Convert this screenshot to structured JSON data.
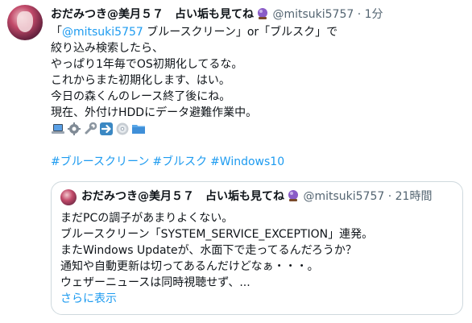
{
  "tweet": {
    "display_name": "おだみつき@美月５７　占い垢も見てね",
    "handle": "@mitsuki5757",
    "separator": "·",
    "time": "1分",
    "text_lines": [
      [
        "「",
        "@mitsuki5757",
        " ブルースクリーン」or「ブルスク」で"
      ],
      "絞り込み検索したら、",
      "やっぱり1年毎でOS初期化してるな。",
      "これからまた初期化します、はい。",
      "今日の森くんのレース終了後にね。",
      "現在、外付けHDDにデータ避難作業中。"
    ],
    "emoji_icons": [
      "laptop-icon",
      "gear-icon",
      "wrench-icon",
      "right-arrow-icon",
      "disc-icon",
      "folder-icon"
    ],
    "hashtags": [
      "#ブルースクリーン",
      "#ブルスク",
      "#Windows10"
    ]
  },
  "quoted": {
    "display_name": "おだみつき@美月５７　占い垢も見てね",
    "handle": "@mitsuki5757",
    "separator": "·",
    "time": "21時間",
    "text_lines": [
      "まだPCの調子があまりよくない。",
      "ブルースクリーン「SYSTEM_SERVICE_EXCEPTION」連発。",
      "またWindows Updateが、水面下で走ってるんだろうか？",
      "通知や自動更新は切ってあるんだけどなぁ・・・。",
      "ウェザーニュースは同時視聴せず、..."
    ],
    "show_more": "さらに表示"
  },
  "colors": {
    "link": "#1d9bf0",
    "text": "#0f1419",
    "secondary": "#536471",
    "border": "#cfd9de"
  }
}
